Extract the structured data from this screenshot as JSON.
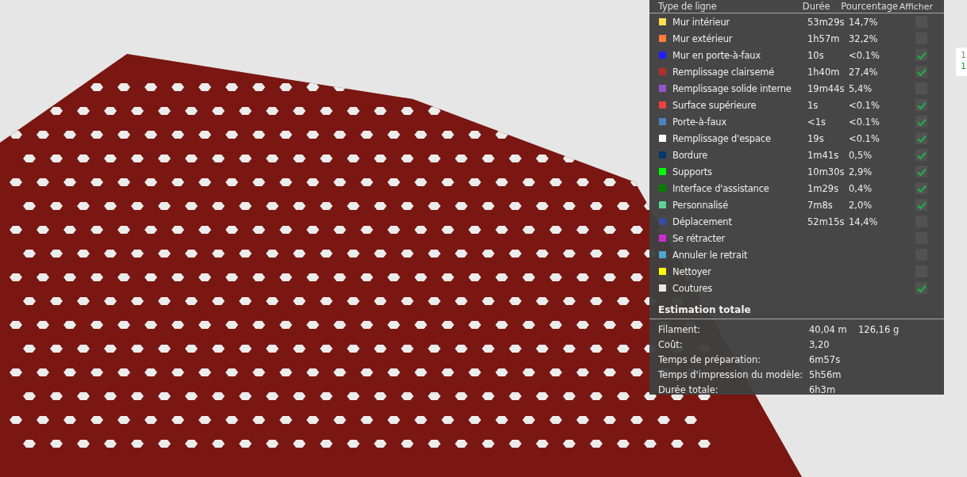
{
  "legend": {
    "columns": [
      "Type de ligne",
      "Durée",
      "Pourcentage",
      "Afficher"
    ],
    "rows": [
      {
        "name": "Mur intérieur",
        "color": "#ffe04a",
        "duration": "53m29s",
        "percent": "14,7%",
        "checked": false
      },
      {
        "name": "Mur extérieur",
        "color": "#ff7d38",
        "duration": "1h57m",
        "percent": "32,2%",
        "checked": false
      },
      {
        "name": "Mur en porte-à-faux",
        "color": "#1f1fff",
        "duration": "10s",
        "percent": "<0.1%",
        "checked": true
      },
      {
        "name": "Remplissage clairsemé",
        "color": "#b03029",
        "duration": "1h40m",
        "percent": "27,4%",
        "checked": true
      },
      {
        "name": "Remplissage solide interne",
        "color": "#9654cc",
        "duration": "19m44s",
        "percent": "5,4%",
        "checked": false
      },
      {
        "name": "Surface supérieure",
        "color": "#f04040",
        "duration": "1s",
        "percent": "<0.1%",
        "checked": true
      },
      {
        "name": "Porte-à-faux",
        "color": "#4b82c2",
        "duration": "<1s",
        "percent": "<0.1%",
        "checked": true
      },
      {
        "name": "Remplissage d'espace",
        "color": "#ffffff",
        "duration": "19s",
        "percent": "<0.1%",
        "checked": true
      },
      {
        "name": "Bordure",
        "color": "#00386b",
        "duration": "1m41s",
        "percent": "0,5%",
        "checked": true
      },
      {
        "name": "Supports",
        "color": "#00ff00",
        "duration": "10m30s",
        "percent": "2,9%",
        "checked": true
      },
      {
        "name": "Interface d'assistance",
        "color": "#008000",
        "duration": "1m29s",
        "percent": "0,4%",
        "checked": true
      },
      {
        "name": "Personnalisé",
        "color": "#5ed194",
        "duration": "7m8s",
        "percent": "2,0%",
        "checked": true
      },
      {
        "name": "Déplacement",
        "color": "#384ba3",
        "duration": "52m15s",
        "percent": "14,4%",
        "checked": false
      },
      {
        "name": "Se rétracter",
        "color": "#cc2ecc",
        "duration": "",
        "percent": "",
        "checked": false
      },
      {
        "name": "Annuler le retrait",
        "color": "#4aa8cc",
        "duration": "",
        "percent": "",
        "checked": false
      },
      {
        "name": "Nettoyer",
        "color": "#ffff00",
        "duration": "",
        "percent": "",
        "checked": false
      },
      {
        "name": "Coutures",
        "color": "#e6e6e6",
        "duration": "",
        "percent": "",
        "checked": true
      }
    ]
  },
  "estimate": {
    "title": "Estimation totale",
    "rows": [
      {
        "label": "Filament:",
        "value": "40,04 m",
        "extra": "126,16 g"
      },
      {
        "label": "Coût:",
        "value": "3,20"
      },
      {
        "label": "Temps de préparation:",
        "value": "6m57s"
      },
      {
        "label": "Temps d'impression du modèle:",
        "value": "5h56m"
      },
      {
        "label": "Durée totale:",
        "value": "6h3m"
      }
    ]
  },
  "side_card": {
    "lines": [
      "1",
      "1"
    ]
  }
}
